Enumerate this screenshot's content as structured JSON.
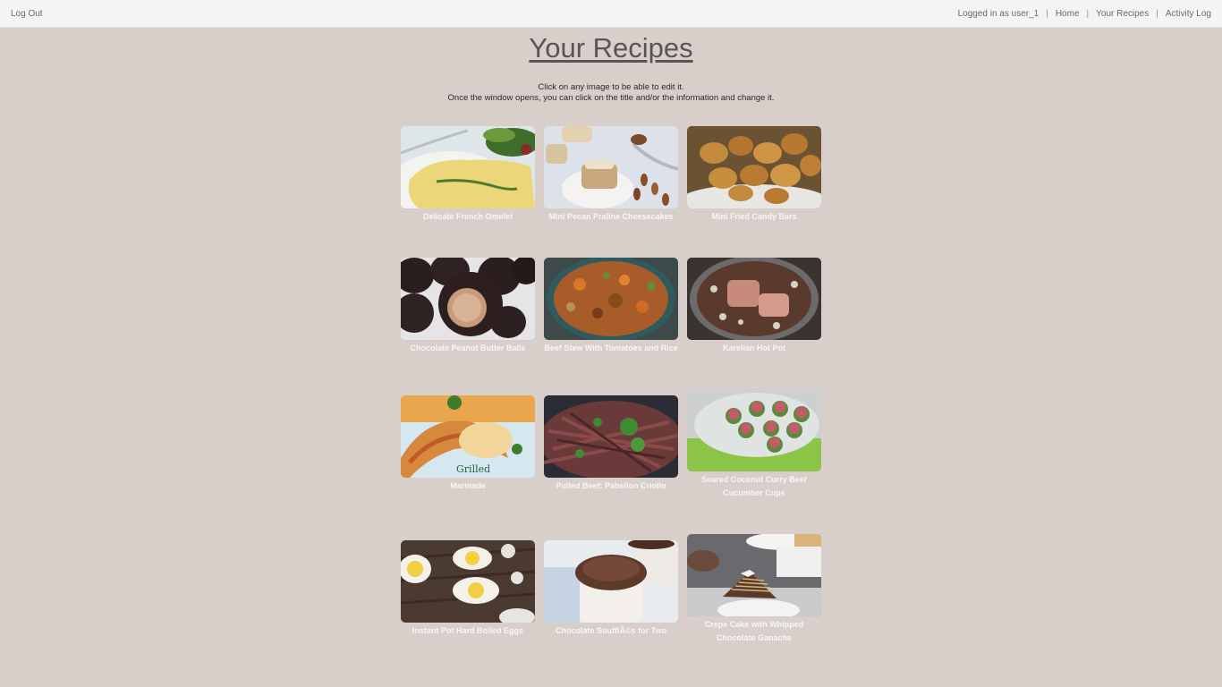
{
  "nav": {
    "logout": "Log Out",
    "logged_in": "Logged in as user_1",
    "separator": "|",
    "home": "Home",
    "your_recipes": "Your Recipes",
    "activity_log": "Activity Log"
  },
  "page": {
    "title": "Your Recipes",
    "instruction_line1": "Click on any image to be able to edit it.",
    "instruction_line2": "Once the window opens, you can click on the title and/or the information and change it."
  },
  "recipes": [
    {
      "title": "Delicate French Omelet",
      "image": "omelet-photo"
    },
    {
      "title": "Mini Pecan Praline Cheesecakes",
      "image": "cheesecake-photo"
    },
    {
      "title": "Mini Fried Candy Bars",
      "image": "fried-candy-photo"
    },
    {
      "title": "Chocolate Peanut Butter Balls",
      "image": "chocolate-balls-photo"
    },
    {
      "title": "Beef Stew With Tomatoes and Rice",
      "image": "beef-stew-photo"
    },
    {
      "title": "Karelian Hot Pot",
      "image": "hot-pot-photo"
    },
    {
      "title": "Marinade",
      "image": "shrimp-photo",
      "overlay_text": "Grilled"
    },
    {
      "title": "Pulled Beef: Pabellon Criollo",
      "image": "pulled-beef-photo"
    },
    {
      "title": "Seared Coconut Curry Beef Cucumber Cups",
      "image": "cucumber-cups-photo"
    },
    {
      "title": "Instant Pot Hard Boiled Eggs",
      "image": "eggs-photo"
    },
    {
      "title": "Chocolate SoufflÃ©s for Two",
      "image": "souffle-photo"
    },
    {
      "title": "Crepe Cake with Whipped Chocolate Ganache",
      "image": "crepe-cake-photo"
    }
  ]
}
